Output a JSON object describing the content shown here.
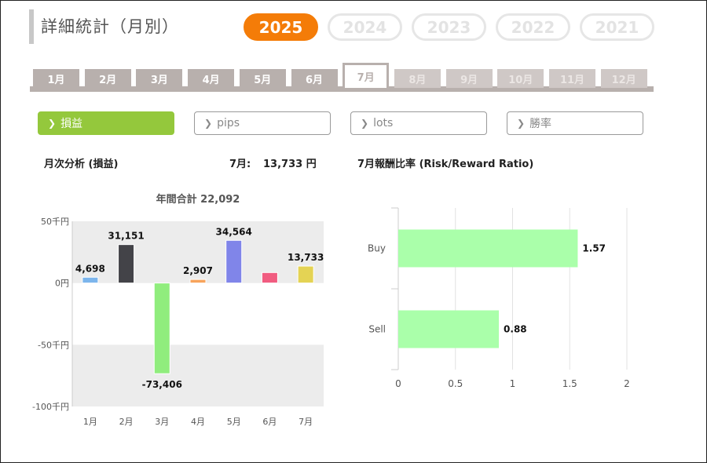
{
  "page": {
    "title": "詳細統計（月別）"
  },
  "years": [
    {
      "label": "2025",
      "active": true
    },
    {
      "label": "2024",
      "active": false
    },
    {
      "label": "2023",
      "active": false
    },
    {
      "label": "2022",
      "active": false
    },
    {
      "label": "2021",
      "active": false
    }
  ],
  "months": [
    {
      "label": "1月",
      "state": "normal"
    },
    {
      "label": "2月",
      "state": "normal"
    },
    {
      "label": "3月",
      "state": "normal"
    },
    {
      "label": "4月",
      "state": "normal"
    },
    {
      "label": "5月",
      "state": "normal"
    },
    {
      "label": "6月",
      "state": "normal"
    },
    {
      "label": "7月",
      "state": "active"
    },
    {
      "label": "8月",
      "state": "future"
    },
    {
      "label": "9月",
      "state": "future"
    },
    {
      "label": "10月",
      "state": "future"
    },
    {
      "label": "11月",
      "state": "future"
    },
    {
      "label": "12月",
      "state": "future"
    }
  ],
  "metrics": [
    {
      "label": "損益",
      "active": true
    },
    {
      "label": "pips",
      "active": false
    },
    {
      "label": "lots",
      "active": false
    },
    {
      "label": "勝率",
      "active": false
    }
  ],
  "monthly": {
    "heading": "月次分析 (損益)",
    "current_label": "7月:",
    "current_value": "13,733 円",
    "annual_total": "年間合計 22,092"
  },
  "rr": {
    "heading": "7月報酬比率 (Risk/Reward Ratio)"
  },
  "colors": {
    "accent_orange": "#f47c08",
    "accent_green": "#94c83c",
    "tab_gray": "#b8b0ad"
  },
  "chart_data": [
    {
      "type": "bar",
      "title": "年間合計 22,092",
      "categories": [
        "1月",
        "2月",
        "3月",
        "4月",
        "5月",
        "6月",
        "7月"
      ],
      "values": [
        4698,
        31151,
        -73406,
        2907,
        34564,
        8500,
        13733
      ],
      "value_labels": [
        "4,698",
        "31,151",
        "-73,406",
        "2,907",
        "34,564",
        "",
        "13,733"
      ],
      "bar_colors": [
        "#7cb5ec",
        "#434348",
        "#90ed7d",
        "#f7a35c",
        "#8085e9",
        "#f15c80",
        "#e4d354"
      ],
      "ylim": [
        -100000,
        50000
      ],
      "yticks": [
        50000,
        0,
        -50000,
        -100000
      ],
      "ytick_labels": [
        "50千円",
        "0円",
        "-50千円",
        "-100千円"
      ]
    },
    {
      "type": "bar",
      "orientation": "horizontal",
      "categories": [
        "Buy",
        "Sell"
      ],
      "values": [
        1.57,
        0.88
      ],
      "value_labels": [
        "1.57",
        "0.88"
      ],
      "bar_color": "#aaffaa",
      "xlim": [
        0,
        2
      ],
      "xticks": [
        0,
        0.5,
        1,
        1.5,
        2
      ],
      "xtick_labels": [
        "0",
        "0.5",
        "1",
        "1.5",
        "2"
      ]
    }
  ]
}
